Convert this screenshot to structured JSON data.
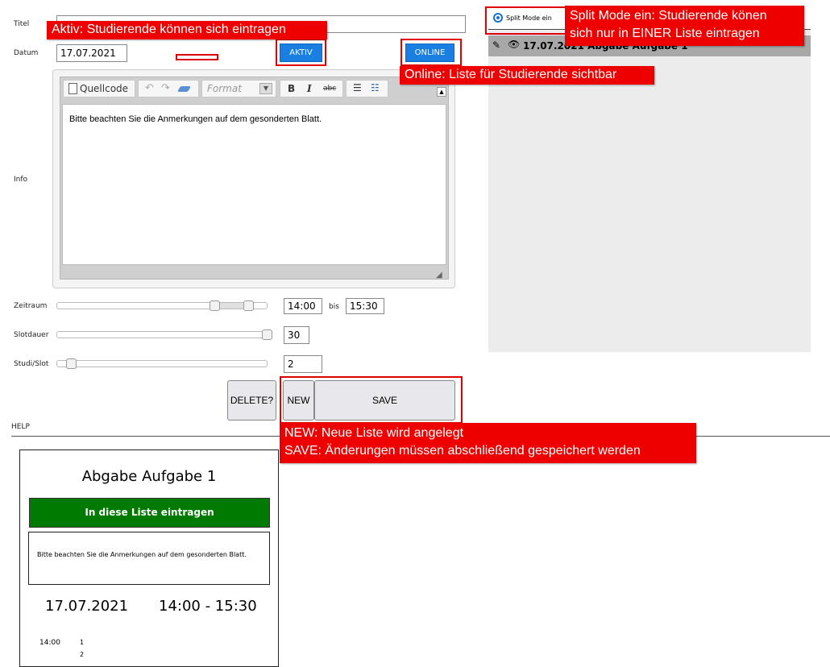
{
  "form": {
    "titel_label": "Titel",
    "titel_value": "",
    "datum_label": "Datum",
    "datum_value": "17.07.2021",
    "aktiv_label": "AKTIV",
    "online_label": "ONLINE",
    "info_label": "Info",
    "zeitraum_label": "Zeitraum",
    "zeit_start": "14:00",
    "bis_label": "bis",
    "zeit_end": "15:30",
    "slotdauer_label": "Slotdauer",
    "slotdauer_value": "30",
    "studi_label": "Studi/Slot",
    "studi_value": "2",
    "delete_label": "DELETE?",
    "new_label": "NEW",
    "save_label": "SAVE",
    "help_label": "HELP"
  },
  "editor": {
    "source_label": "Quellcode",
    "format_placeholder": "Format",
    "bold": "B",
    "italic": "I",
    "strike": "abc",
    "content": "Bitte beachten Sie die Anmerkungen auf dem gesonderten Blatt."
  },
  "right_panel": {
    "split_mode_label": "Split Mode ein",
    "list_item": "17.07.2021 Abgabe Aufgabe 1"
  },
  "callouts": {
    "aktiv": "Aktiv: Studierende können sich eintragen",
    "split_line1": "Split Mode ein: Studierende könen",
    "split_line2": "sich nur in EINER Liste eintragen",
    "online": "Online: Liste für Studierende sichtbar",
    "new": "NEW: Neue Liste wird angelegt",
    "save": "SAVE: Änderungen müssen abschließend gespeichert werden"
  },
  "preview": {
    "title": "Abgabe Aufgabe 1",
    "enroll_button": "In diese Liste eintragen",
    "info": "Bitte beachten Sie die Anmerkungen auf dem gesonderten Blatt.",
    "date": "17.07.2021",
    "time_range": "14:00 - 15:30",
    "slot_time": "14:00",
    "slot_1": "1",
    "slot_2": "2"
  },
  "colors": {
    "callout": "#ee0000",
    "button_blue": "#1a7fe0",
    "enroll_green": "#007a00",
    "panel_gray": "#ececec"
  }
}
